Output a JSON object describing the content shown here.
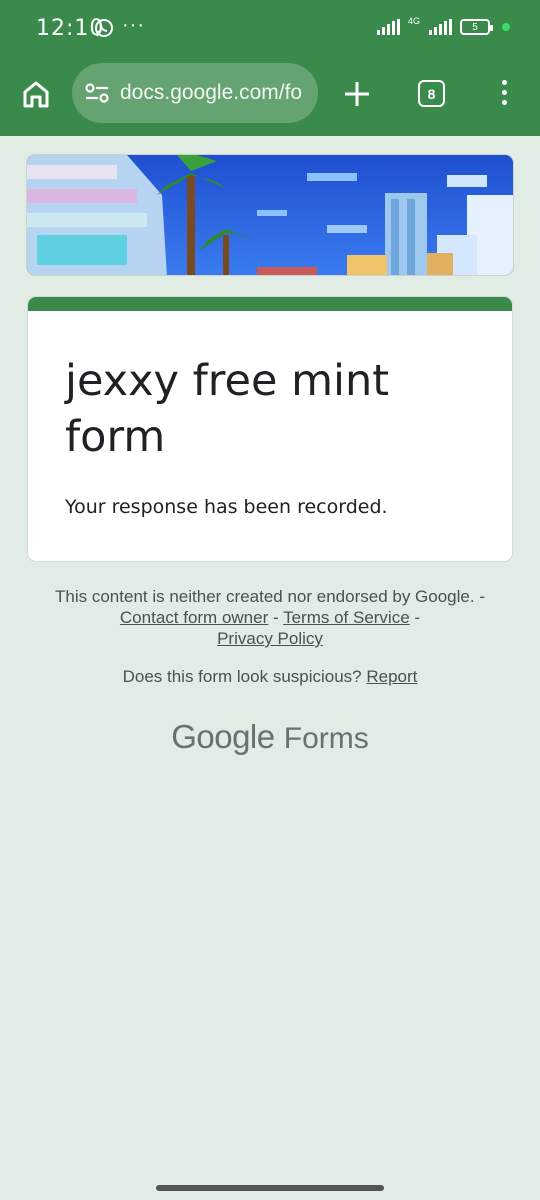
{
  "status_bar": {
    "time": "12:10",
    "more": "···",
    "network_label": "4G",
    "battery": "5"
  },
  "browser": {
    "url": "docs.google.com/fo",
    "tab_count": "8"
  },
  "form": {
    "title": "jexxy free mint form",
    "message": "Your response has been recorded."
  },
  "footer": {
    "disclaimer_text": "This content is neither created nor endorsed by Google. -",
    "contact_link": "Contact form owner",
    "sep1": "-",
    "terms_link": "Terms of Service",
    "sep2": "-",
    "privacy_link": "Privacy Policy",
    "suspicious_text": "Does this form look suspicious?",
    "report_link": "Report",
    "logo_google": "Google",
    "logo_forms": "Forms"
  },
  "colors": {
    "theme_green": "#3a8a4c",
    "page_bg": "#e1ece4"
  },
  "icons": [
    "whatsapp-icon",
    "signal-icon",
    "battery-icon",
    "home-icon",
    "site-settings-icon",
    "plus-icon",
    "tabs-icon",
    "menu-icon"
  ]
}
